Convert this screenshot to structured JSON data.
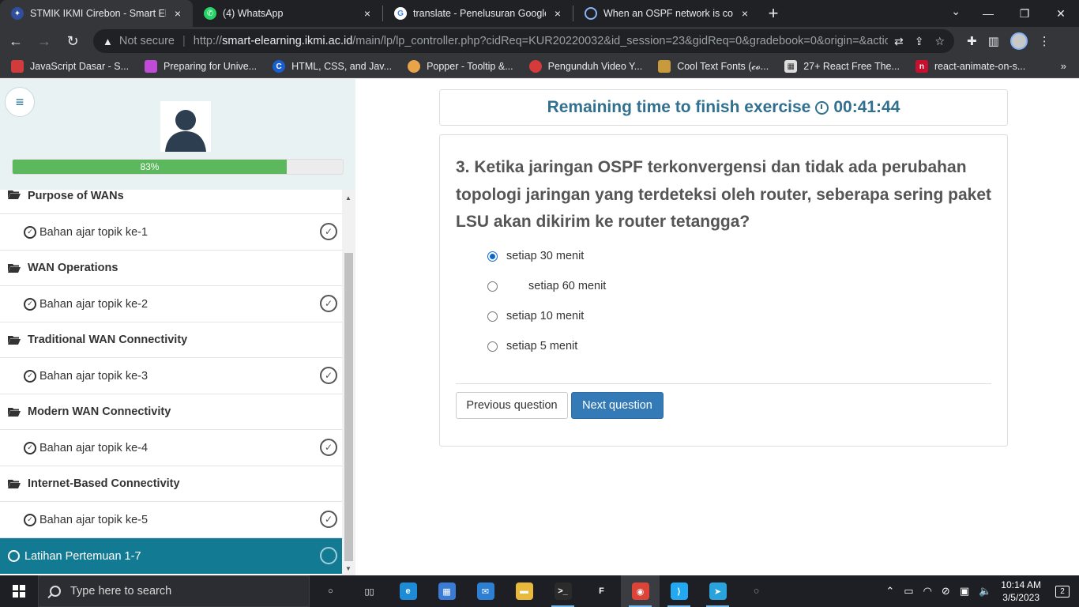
{
  "browser": {
    "tabs": [
      {
        "title": "STMIK IKMI Cirebon - Smart Elea",
        "active": true,
        "icon": "ikmi-favicon"
      },
      {
        "title": "(4) WhatsApp",
        "active": false,
        "icon": "whatsapp-icon"
      },
      {
        "title": "translate - Penelusuran Google",
        "active": false,
        "icon": "google-icon"
      },
      {
        "title": "When an OSPF network is conver",
        "active": false,
        "icon": "brainly-icon"
      }
    ],
    "close_glyph": "×",
    "new_tab_glyph": "+",
    "address": {
      "security_label": "Not secure",
      "scheme": "http://",
      "host": "smart-elearning.ikmi.ac.id",
      "path": "/main/lp/lp_controller.php?cidReq=KUR20220032&id_session=23&gidReq=0&gradebook=0&origin=&action=..."
    },
    "bookmarks": [
      {
        "label": "JavaScript Dasar - S...",
        "color": "#d23b3b"
      },
      {
        "label": "Preparing for Unive...",
        "color": "#c04bd6"
      },
      {
        "label": "HTML, CSS, and Jav...",
        "color": "#1a5fd0"
      },
      {
        "label": "Popper - Tooltip &...",
        "color": "#e8a34b"
      },
      {
        "label": "Pengunduh Video Y...",
        "color": "#d63a3a"
      },
      {
        "label": "Cool Text Fonts (𝓬𝓸...",
        "color": "#c99a3b"
      },
      {
        "label": "27+ React Free The...",
        "color": "#dddddd"
      },
      {
        "label": "react-animate-on-s...",
        "color": "#c8102e"
      }
    ],
    "bookmarks_more": "»"
  },
  "sidebar": {
    "menu_icon": "hamburger-icon",
    "progress_percent": 83,
    "progress_label": "83%",
    "sections": [
      {
        "title": "Purpose of WANs",
        "item": "Bahan ajar topik ke-1"
      },
      {
        "title": "WAN Operations",
        "item": "Bahan ajar topik ke-2"
      },
      {
        "title": "Traditional WAN Connectivity",
        "item": "Bahan ajar topik ke-3"
      },
      {
        "title": "Modern WAN Connectivity",
        "item": "Bahan ajar topik ke-4"
      },
      {
        "title": "Internet-Based Connectivity",
        "item": "Bahan ajar topik ke-5"
      }
    ],
    "active_item": "Latihan Pertemuan 1-7"
  },
  "exercise": {
    "timer_label": "Remaining time to finish exercise",
    "timer_value": "00:41:44",
    "question": "3. Ketika jaringan OSPF terkonvergensi dan tidak ada perubahan topologi jaringan yang terdeteksi oleh router, seberapa sering paket LSU akan dikirim ke router tetangga?",
    "options": [
      {
        "label": "setiap 30 menit",
        "selected": true
      },
      {
        "label": "setiap 60 menit",
        "selected": false
      },
      {
        "label": "setiap 10 menit",
        "selected": false
      },
      {
        "label": "setiap 5 menit",
        "selected": false
      }
    ],
    "prev_label": "Previous question",
    "next_label": "Next question"
  },
  "taskbar": {
    "search_placeholder": "Type here to search",
    "time": "10:14 AM",
    "date": "3/5/2023",
    "notification_count": "2",
    "apps": [
      {
        "name": "cortana-icon",
        "color": "#1d1f25",
        "glyph": "○"
      },
      {
        "name": "task-view-icon",
        "color": "#1d1f25",
        "glyph": "▯▯"
      },
      {
        "name": "edge-icon",
        "color": "#1d8bd6",
        "glyph": "e"
      },
      {
        "name": "store-icon",
        "color": "#3a7bd5",
        "glyph": "▦"
      },
      {
        "name": "mail-icon",
        "color": "#2d7fd3",
        "glyph": "✉"
      },
      {
        "name": "file-explorer-icon",
        "color": "#e8b93b",
        "glyph": "▬"
      },
      {
        "name": "terminal-icon",
        "color": "#2b2b2b",
        "glyph": ">_"
      },
      {
        "name": "figma-icon",
        "color": "#1d1f25",
        "glyph": "F"
      },
      {
        "name": "chrome-icon",
        "color": "#db4437",
        "glyph": "◉"
      },
      {
        "name": "vscode-icon",
        "color": "#23a9f2",
        "glyph": "⟩"
      },
      {
        "name": "telegram-icon",
        "color": "#2aa3dc",
        "glyph": "➤"
      },
      {
        "name": "obs-icon",
        "color": "#1d1f25",
        "glyph": "◌"
      }
    ]
  }
}
